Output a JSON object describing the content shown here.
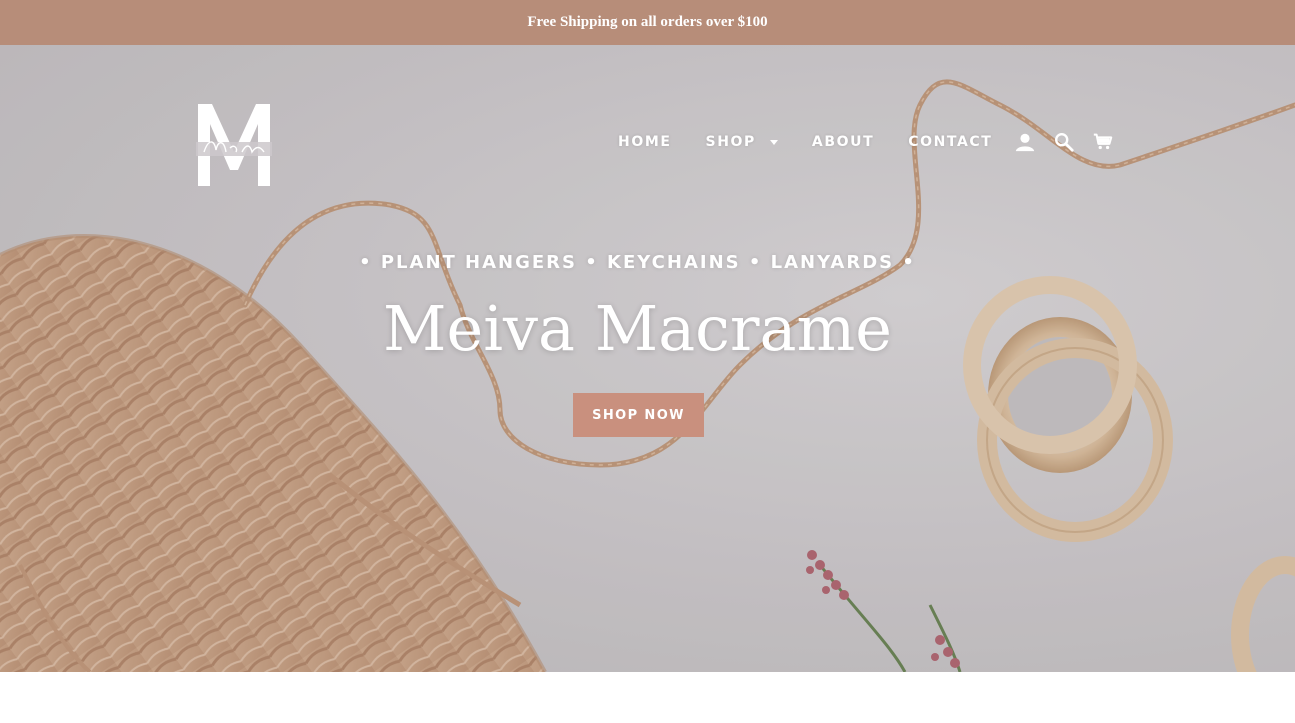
{
  "announcement": {
    "text": "Free Shipping on all orders over $100"
  },
  "brand": {
    "logo_icon": "meiva-macrame-monogram-logo"
  },
  "nav": {
    "items": [
      {
        "label": "HOME"
      },
      {
        "label": "SHOP",
        "has_dropdown": true
      },
      {
        "label": "ABOUT"
      },
      {
        "label": "CONTACT"
      }
    ],
    "icons": [
      "account-icon",
      "search-icon",
      "cart-icon"
    ]
  },
  "hero": {
    "tagline": "• PLANT HANGERS • KEYCHAINS • LANYARDS •",
    "title": "Meiva Macrame",
    "cta_label": "SHOP NOW"
  },
  "colors": {
    "announcement_bg": "#b78d79",
    "cta_bg": "#c9907e",
    "text_on_hero": "#ffffff"
  }
}
